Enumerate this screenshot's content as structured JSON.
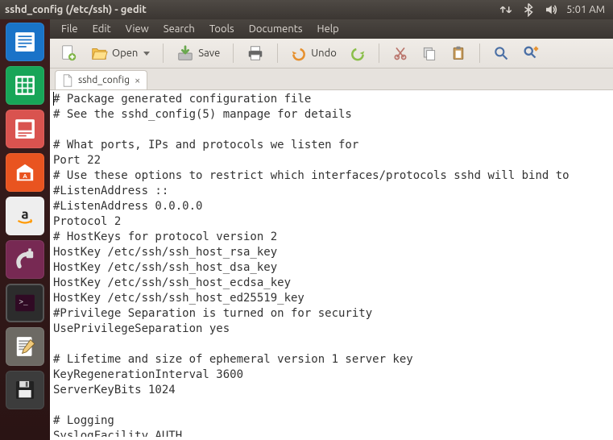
{
  "window": {
    "title": "sshd_config (/etc/ssh) - gedit"
  },
  "tray": {
    "clock": "5:01 AM"
  },
  "menus": {
    "file": "File",
    "edit": "Edit",
    "view": "View",
    "search": "Search",
    "tools": "Tools",
    "documents": "Documents",
    "help": "Help"
  },
  "toolbar": {
    "open": "Open",
    "save": "Save",
    "undo": "Undo"
  },
  "tab": {
    "label": "sshd_config"
  },
  "file_content": "# Package generated configuration file\n# See the sshd_config(5) manpage for details\n\n# What ports, IPs and protocols we listen for\nPort 22\n# Use these options to restrict which interfaces/protocols sshd will bind to\n#ListenAddress ::\n#ListenAddress 0.0.0.0\nProtocol 2\n# HostKeys for protocol version 2\nHostKey /etc/ssh/ssh_host_rsa_key\nHostKey /etc/ssh/ssh_host_dsa_key\nHostKey /etc/ssh/ssh_host_ecdsa_key\nHostKey /etc/ssh/ssh_host_ed25519_key\n#Privilege Separation is turned on for security\nUsePrivilegeSeparation yes\n\n# Lifetime and size of ephemeral version 1 server key\nKeyRegenerationInterval 3600\nServerKeyBits 1024\n\n# Logging\nSyslogFacility AUTH\nLogLevel INFO"
}
